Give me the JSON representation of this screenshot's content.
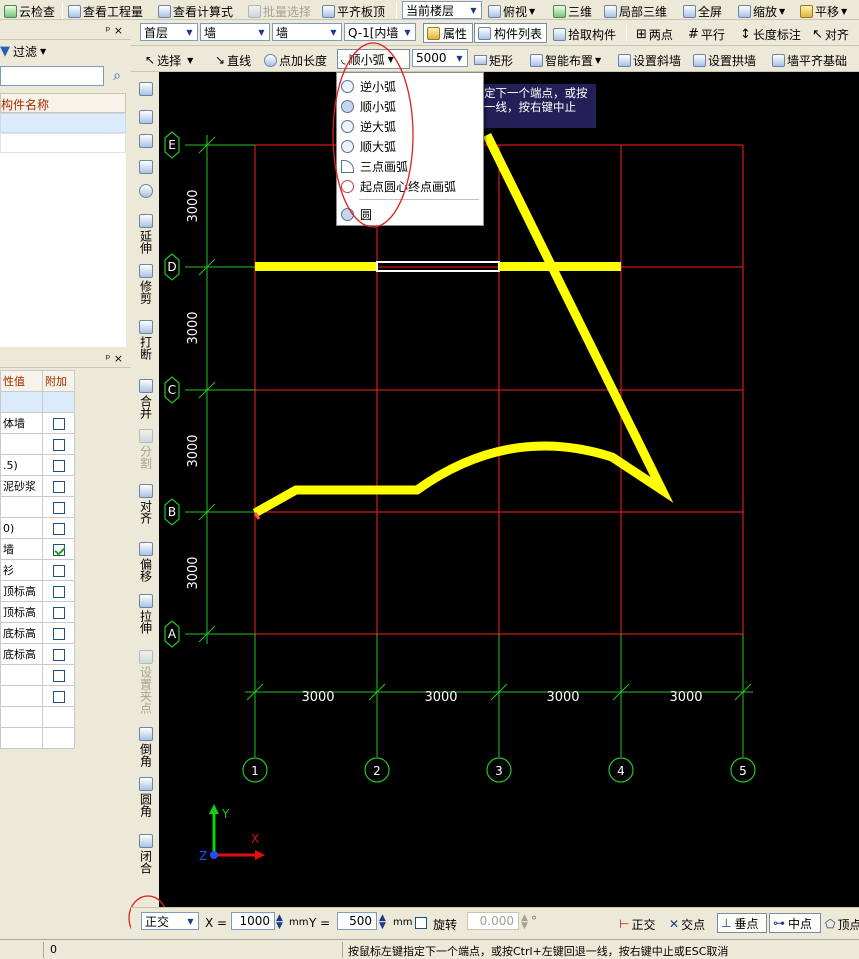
{
  "toolbar1": {
    "cloud_check": "云检查",
    "view_quantity": "查看工程量",
    "view_formula": "查看计算式",
    "batch_select": "批量选择",
    "flush_slab_top": "平齐板顶",
    "floor_combo": "当前楼层",
    "top_view": "俯视",
    "three_d": "三维",
    "local_3d": "局部三维",
    "fullscreen": "全屏",
    "zoom": "缩放",
    "pan": "平移"
  },
  "toolbar2": {
    "floor": "首层",
    "category": "墙",
    "subtype": "墙",
    "component": "Q-1[内墙",
    "properties": "属性",
    "component_list": "构件列表",
    "pick_component": "拾取构件",
    "two_points": "两点",
    "parallel": "平行",
    "length_dim": "长度标注",
    "align": "对齐"
  },
  "toolbar3": {
    "select": "选择",
    "line": "直线",
    "point_length": "点加长度",
    "arc_mode": "顺小弧",
    "radius": "5000",
    "rectangle": "矩形",
    "smart_layout": "智能布置",
    "set_slope_wall": "设置斜墙",
    "set_arch_wall": "设置拱墙",
    "flush_foundation": "墙平齐基础"
  },
  "arc_menu": {
    "items": [
      "逆小弧",
      "顺小弧",
      "逆大弧",
      "顺大弧",
      "三点画弧",
      "起点圆心终点画弧",
      "圆"
    ]
  },
  "tooltip": {
    "line1": "定下一个端点，或按",
    "line2": "一线，按右键中止"
  },
  "left_top_panel": {
    "pin": "ᵖ ×",
    "filter": "过滤",
    "column_header": "构件名称"
  },
  "left_bottom_panel": {
    "pin": "ᵖ ×",
    "col_value": "性值",
    "col_extra": "附加",
    "rows": [
      {
        "value": "",
        "checked": null
      },
      {
        "value": "体墙",
        "checked": false
      },
      {
        "value": "",
        "checked": false
      },
      {
        "value": ".5)",
        "checked": false
      },
      {
        "value": "泥砂浆",
        "checked": false
      },
      {
        "value": "",
        "checked": false
      },
      {
        "value": "0)",
        "checked": false
      },
      {
        "value": "墙",
        "checked": true
      },
      {
        "value": "衫",
        "checked": false
      },
      {
        "value": "顶标高",
        "checked": false
      },
      {
        "value": "顶标高",
        "checked": false
      },
      {
        "value": "底标高",
        "checked": false
      },
      {
        "value": "底标高",
        "checked": false
      },
      {
        "value": "",
        "checked": false
      },
      {
        "value": "",
        "checked": false
      },
      {
        "value": "",
        "checked": null
      },
      {
        "value": "",
        "checked": null
      }
    ]
  },
  "vertical_tools": [
    "延伸",
    "修剪",
    "打断",
    "合并",
    "分割",
    "对齐",
    "偏移",
    "拉伸",
    "设置夹点",
    "倒角",
    "圆角",
    "闭合"
  ],
  "drawing": {
    "row_axes": [
      "E",
      "D",
      "C",
      "B",
      "A"
    ],
    "col_axes": [
      "1",
      "2",
      "3",
      "4",
      "5"
    ],
    "row_spacing": [
      "3000",
      "3000",
      "3000",
      "3000"
    ],
    "col_spacing": [
      "3000",
      "3000",
      "3000",
      "3000"
    ],
    "ucs_x": "X",
    "ucs_y": "Y",
    "ucs_z": "Z"
  },
  "bottom_bar": {
    "ortho_mode": "正交",
    "x_label": "X =",
    "x_value": "1000",
    "x_unit": "mm",
    "y_label": "Y =",
    "y_value": "500",
    "y_unit": "mm",
    "rotate": "旋转",
    "rotate_value": "0.000",
    "degree": "°",
    "snap_ortho": "正交",
    "snap_intersect": "交点",
    "snap_perp": "垂点",
    "snap_mid": "中点",
    "snap_vertex": "顶点"
  },
  "status": {
    "left_value": "0",
    "message": "按鼠标左键指定下一个端点，或按Ctrl+左键回退一线，按右键中止或ESC取消"
  },
  "colors": {
    "grid_red": "#ff2020",
    "axis_green": "#25c425",
    "wall_yellow": "#ffff00",
    "annotation_red": "#e02020"
  }
}
